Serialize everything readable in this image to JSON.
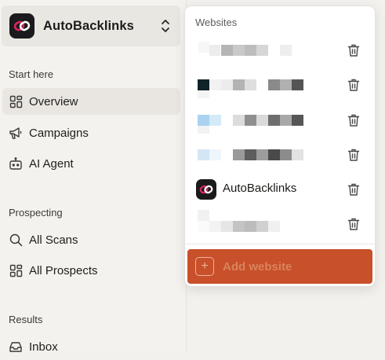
{
  "workspace": {
    "name": "AutoBacklinks"
  },
  "sidebar": {
    "sections": [
      {
        "label": "Start here"
      },
      {
        "label": "Prospecting"
      },
      {
        "label": "Results"
      }
    ],
    "items": [
      {
        "label": "Overview",
        "icon": "grid-icon",
        "active": true
      },
      {
        "label": "Campaigns",
        "icon": "megaphone-icon"
      },
      {
        "label": "AI Agent",
        "icon": "bot-icon"
      },
      {
        "label": "All Scans",
        "icon": "search-icon"
      },
      {
        "label": "All Prospects",
        "icon": "grid-icon"
      },
      {
        "label": "Inbox",
        "icon": "inbox-icon"
      }
    ]
  },
  "dropdown": {
    "title": "Websites",
    "sites": [
      {
        "name": "",
        "redacted": true
      },
      {
        "name": "",
        "redacted": true
      },
      {
        "name": "",
        "redacted": true
      },
      {
        "name": "",
        "redacted": true
      },
      {
        "name": "AutoBacklinks",
        "redacted": false
      },
      {
        "name": "",
        "redacted": true
      }
    ],
    "add_label": "Add website"
  },
  "colors": {
    "accent": "#c8502a",
    "logo_bg": "#1b1a1c",
    "logo_mark": "#e0245e"
  }
}
